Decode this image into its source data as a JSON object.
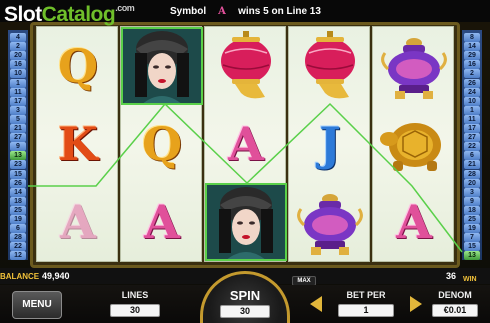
{
  "header": {
    "logo": {
      "slot": "Slot",
      "catalog": "Catalog",
      "com": ".com"
    },
    "win_message": {
      "prefix": "Symbol",
      "symbol_icon": "letter-a-icon",
      "text": "wins 5 on Line 13"
    }
  },
  "paylines": {
    "left": [
      "4",
      "2",
      "20",
      "16",
      "10",
      "1",
      "11",
      "17",
      "3",
      "5",
      "21",
      "27",
      "9",
      "13",
      "23",
      "15",
      "26",
      "14",
      "18",
      "25",
      "19",
      "6",
      "28",
      "22",
      "12"
    ],
    "right": [
      "8",
      "14",
      "29",
      "16",
      "2",
      "26",
      "24",
      "10",
      "1",
      "11",
      "17",
      "27",
      "22",
      "6",
      "21",
      "28",
      "20",
      "3",
      "9",
      "18",
      "25",
      "19",
      "7",
      "15",
      "13"
    ]
  },
  "reels": [
    {
      "symbols": [
        "Q",
        "K",
        "A"
      ],
      "highlight": [
        false,
        false,
        true
      ]
    },
    {
      "symbols": [
        "geisha",
        "Q",
        "A"
      ],
      "highlight": [
        true,
        false,
        true
      ]
    },
    {
      "symbols": [
        "lantern",
        "A",
        "geisha"
      ],
      "highlight": [
        false,
        false,
        true
      ]
    },
    {
      "symbols": [
        "lantern",
        "J",
        "vase"
      ],
      "highlight": [
        false,
        false,
        true
      ]
    },
    {
      "symbols": [
        "vase",
        "tortoise",
        "A"
      ],
      "highlight": [
        false,
        false,
        true
      ]
    }
  ],
  "status": {
    "balance_label": "BALANCE",
    "balance_value": "49,940",
    "win_value": "36",
    "win_label": "WIN",
    "max_label": "MAX"
  },
  "controls": {
    "menu_label": "MENU",
    "lines_label": "LINES",
    "lines_value": "30",
    "spin_label": "SPIN",
    "spin_value": "30",
    "bet_per_label": "BET PER",
    "bet_per_value": "1",
    "denom_label": "DENOM",
    "denom_value": "€0.01"
  },
  "colors": {
    "accent_gold": "#e2b73b",
    "win_line": "#5ad04a",
    "line_badge": "#4e7ec8"
  }
}
